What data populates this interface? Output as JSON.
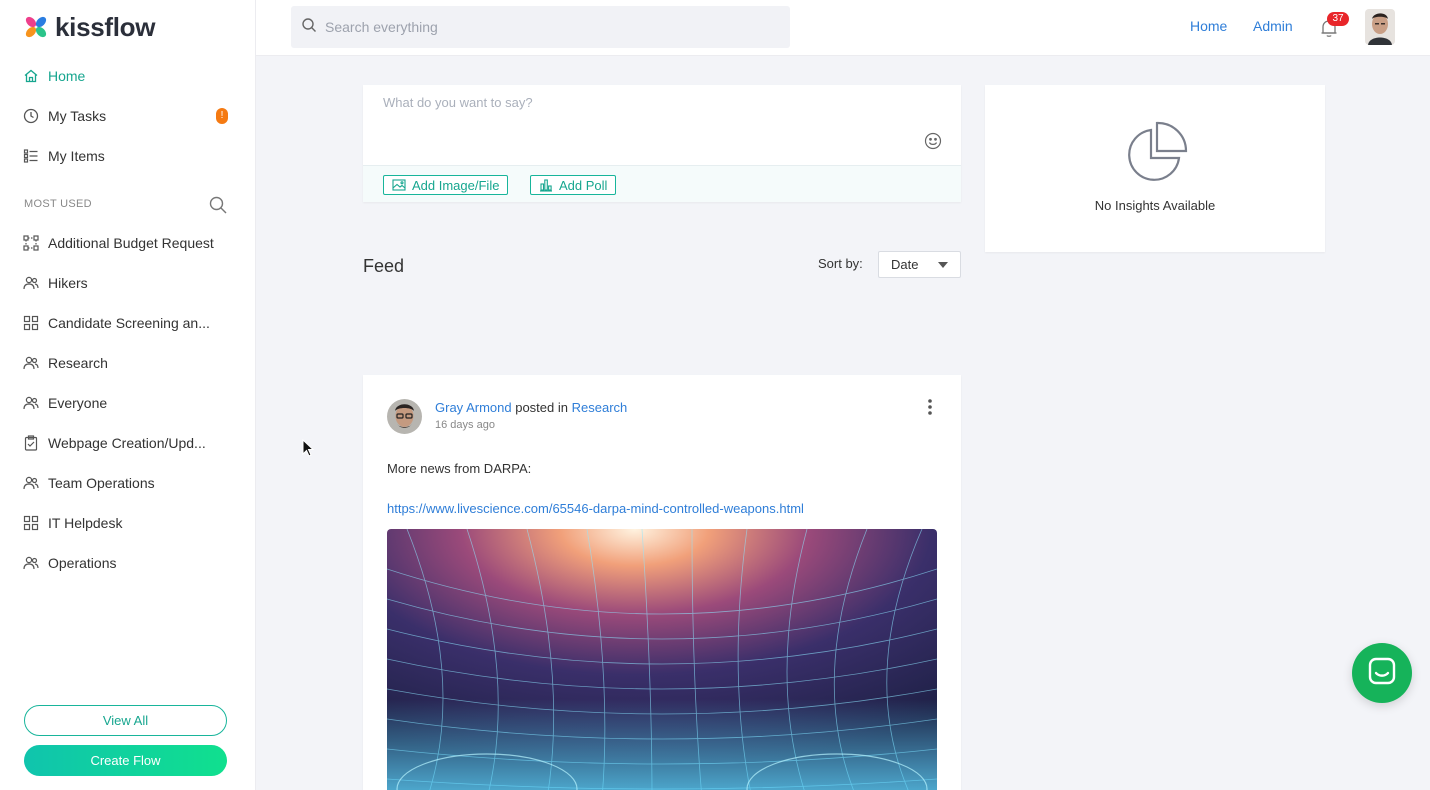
{
  "brand": {
    "name": "kissflow",
    "colors": {
      "pink": "#ee3f8b",
      "orange": "#f7941d",
      "blue": "#2a7de1",
      "green": "#2bc48a"
    }
  },
  "sidebar": {
    "nav": [
      {
        "label": "Home",
        "icon": "home-icon",
        "active": true
      },
      {
        "label": "My Tasks",
        "icon": "clock-icon",
        "badge": "!"
      },
      {
        "label": "My Items",
        "icon": "list-icon"
      }
    ],
    "most_used_title": "MOST USED",
    "most_used": [
      {
        "label": "Additional Budget Request",
        "icon": "process-icon"
      },
      {
        "label": "Hikers",
        "icon": "people-icon"
      },
      {
        "label": "Candidate Screening an...",
        "icon": "grid-icon"
      },
      {
        "label": "Research",
        "icon": "people-icon"
      },
      {
        "label": "Everyone",
        "icon": "people-icon"
      },
      {
        "label": "Webpage Creation/Upd...",
        "icon": "clipboard-icon"
      },
      {
        "label": "Team Operations",
        "icon": "people-icon"
      },
      {
        "label": "IT Helpdesk",
        "icon": "grid-icon"
      },
      {
        "label": "Operations",
        "icon": "people-icon"
      }
    ],
    "view_all": "View All",
    "create_flow": "Create Flow"
  },
  "header": {
    "search_placeholder": "Search everything",
    "links": [
      "Home",
      "Admin"
    ],
    "notification_count": "37"
  },
  "composer": {
    "placeholder": "What do you want to say?",
    "add_image_label": "Add Image/File",
    "add_poll_label": "Add Poll"
  },
  "insights": {
    "empty_text": "No Insights Available"
  },
  "feed": {
    "title": "Feed",
    "sort_label": "Sort by:",
    "sort_value": "Date",
    "posts": [
      {
        "author": "Gray Armond",
        "posted_in_text": "posted in",
        "channel": "Research",
        "time": "16 days ago",
        "text": "More news from DARPA:",
        "link": "https://www.livescience.com/65546-darpa-mind-controlled-weapons.html"
      }
    ]
  }
}
